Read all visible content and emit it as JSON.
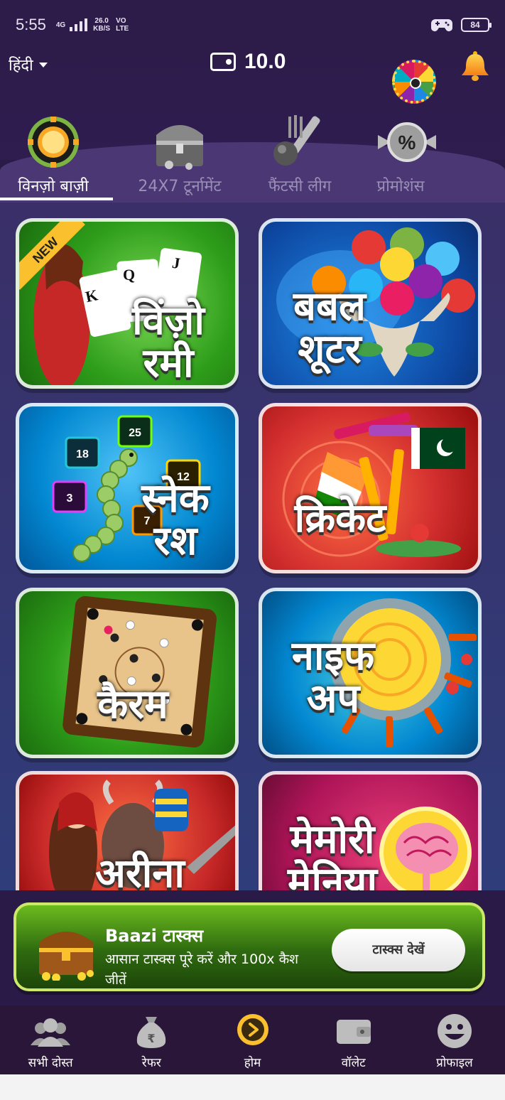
{
  "status_bar": {
    "time": "5:55",
    "network": "4G",
    "speed_value": "26.0",
    "speed_unit": "KB/S",
    "volte_top": "VO",
    "volte_bottom": "LTE",
    "battery": "84"
  },
  "header": {
    "language": "हिंदी",
    "wallet_amount": "10.0",
    "icons": [
      "wallet-icon",
      "spin-wheel-icon",
      "bell-icon"
    ]
  },
  "tabs": [
    {
      "label": "विनज़ो बाज़ी",
      "icon": "gold-chip-icon",
      "active": true
    },
    {
      "label": "24X7 टूर्नामेंट",
      "icon": "treasure-chest-icon",
      "active": false
    },
    {
      "label": "फैंटसी लीग",
      "icon": "cricket-bat-ball-icon",
      "active": false
    },
    {
      "label": "प्रोमोशंस",
      "icon": "percent-candy-icon",
      "active": false
    }
  ],
  "games": [
    {
      "title_line1": "विंज़ो",
      "title_line2": "रमी",
      "badge": "NEW",
      "card_k": "K",
      "card_q": "Q",
      "card_j": "J"
    },
    {
      "title_line1": "बबल",
      "title_line2": "शूटर"
    },
    {
      "title_line1": "स्नेक",
      "title_line2": "रश",
      "tiles": [
        "18",
        "25",
        "12",
        "3",
        "7"
      ]
    },
    {
      "title_line1": "क्रिकेट",
      "title_line2": ""
    },
    {
      "title_line1": "",
      "title_line2": "कैरम"
    },
    {
      "title_line1": "नाइफ",
      "title_line2": "अप"
    },
    {
      "title_line1": "अरीना",
      "title_line2": ""
    },
    {
      "title_line1": "मेमोरी",
      "title_line2": "मेनिया"
    }
  ],
  "banner": {
    "title": "Baazi टास्क्स",
    "description": "आसान टास्क्स पूरे करें और 100x कैश जीतें",
    "button_label": "टास्क्स देखें"
  },
  "bottom_nav": [
    {
      "label": "सभी दोस्त",
      "icon": "friends-icon"
    },
    {
      "label": "रेफर",
      "icon": "money-bag-icon"
    },
    {
      "label": "होम",
      "icon": "home-play-icon"
    },
    {
      "label": "वॉलेट",
      "icon": "wallet-icon"
    },
    {
      "label": "प्रोफाइल",
      "icon": "smiley-profile-icon"
    }
  ]
}
